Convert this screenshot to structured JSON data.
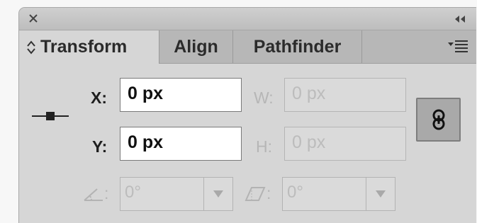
{
  "tabs": [
    {
      "label": "Transform",
      "active": true
    },
    {
      "label": "Align",
      "active": false
    },
    {
      "label": "Pathfinder",
      "active": false
    }
  ],
  "fields": {
    "x": {
      "label": "X:",
      "value": "0 px"
    },
    "y": {
      "label": "Y:",
      "value": "0 px"
    },
    "w": {
      "label": "W:",
      "value": "0 px"
    },
    "h": {
      "label": "H:",
      "value": "0 px"
    }
  },
  "rotate": {
    "label": ":",
    "value": "0°"
  },
  "shear": {
    "label": ":",
    "value": "0°"
  },
  "icons": {
    "close": "close-icon",
    "collapse": "double-chevron-left-icon",
    "panel_menu": "panel-menu-icon",
    "tab_toggle": "up-down-arrows-icon",
    "reference_point": "reference-point-icon",
    "constrain": "chain-link-icon",
    "rotate": "rotate-angle-icon",
    "shear": "shear-icon",
    "dropdown": "triangle-down-icon"
  },
  "colors": {
    "panel_bg": "#d6d6d6",
    "tabstrip_bg": "#b7b7b7",
    "disabled_text": "#b6b6b6",
    "enabled_text": "#1e1e1e"
  }
}
